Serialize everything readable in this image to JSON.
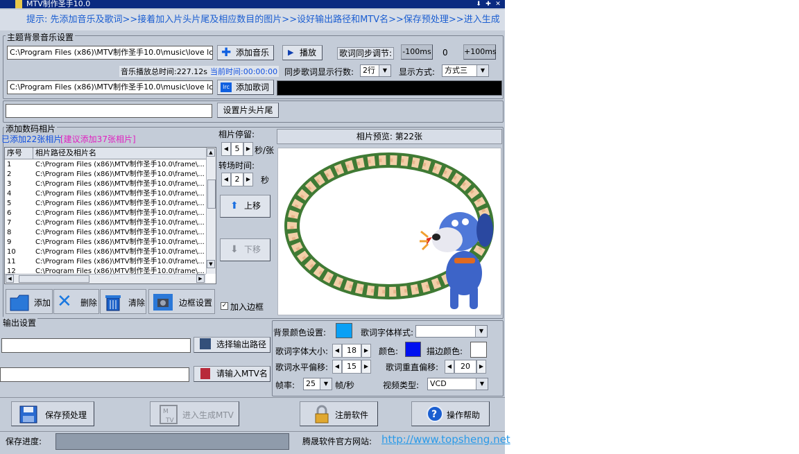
{
  "window": {
    "title": "MTV制作圣手10.0",
    "controls": [
      "⬇",
      "✚",
      "✕"
    ]
  },
  "hint": "提示: 先添加音乐及歌词>>接着加入片头片尾及相应数目的图片>>设好输出路径和MTV名>>保存预处理>>进入生成MTV",
  "music": {
    "group_label": "主题背景音乐设置",
    "music_path": "C:\\Program Files (x86)\\MTV制作圣手10.0\\music\\love love lo",
    "add_music": "添加音乐",
    "play": "播放",
    "sync_label": "歌词同步调节:",
    "minus": "-100ms",
    "offset": "0",
    "plus": "+100ms",
    "total_time": "音乐播放总时间:227.12s",
    "current_time": "当前时间:00:00:00",
    "lines_label": "同步歌词显示行数:",
    "lines_value": "2行",
    "mode_label": "显示方式:",
    "mode_value": "方式三",
    "lyric_path": "C:\\Program Files (x86)\\MTV制作圣手10.0\\music\\love love lo",
    "add_lyric": "添加歌词"
  },
  "trailer": {
    "button": "设置片头片尾",
    "path": ""
  },
  "photos": {
    "group_label": "添加数码相片",
    "added": "已添加22张相片",
    "suggest": "[建议添加37张相片]",
    "col_no": "序号",
    "col_path": "相片路径及相片名",
    "rows": [
      {
        "no": "1",
        "path": "C:\\Program Files (x86)\\MTV制作圣手10.0\\frame\\..."
      },
      {
        "no": "2",
        "path": "C:\\Program Files (x86)\\MTV制作圣手10.0\\frame\\..."
      },
      {
        "no": "3",
        "path": "C:\\Program Files (x86)\\MTV制作圣手10.0\\frame\\..."
      },
      {
        "no": "4",
        "path": "C:\\Program Files (x86)\\MTV制作圣手10.0\\frame\\..."
      },
      {
        "no": "5",
        "path": "C:\\Program Files (x86)\\MTV制作圣手10.0\\frame\\..."
      },
      {
        "no": "6",
        "path": "C:\\Program Files (x86)\\MTV制作圣手10.0\\frame\\..."
      },
      {
        "no": "7",
        "path": "C:\\Program Files (x86)\\MTV制作圣手10.0\\frame\\..."
      },
      {
        "no": "8",
        "path": "C:\\Program Files (x86)\\MTV制作圣手10.0\\frame\\..."
      },
      {
        "no": "9",
        "path": "C:\\Program Files (x86)\\MTV制作圣手10.0\\frame\\..."
      },
      {
        "no": "10",
        "path": "C:\\Program Files (x86)\\MTV制作圣手10.0\\frame\\..."
      },
      {
        "no": "11",
        "path": "C:\\Program Files (x86)\\MTV制作圣手10.0\\frame\\..."
      },
      {
        "no": "12",
        "path": "C:\\Program Files (x86)\\MTV制作圣手10.0\\frame\\..."
      }
    ],
    "stay_label": "相片停留:",
    "stay_value": "5",
    "stay_unit": "秒/张",
    "transition_label": "转场时间:",
    "transition_value": "2",
    "transition_unit": "秒",
    "move_up": "上移",
    "move_down": "下移",
    "preview_label": "相片预览: 第22张",
    "add": "添加",
    "delete": "删除",
    "clear": "清除",
    "frame_setting": "边框设置",
    "add_border": "加入边框"
  },
  "output": {
    "group_label": "输出设置",
    "path": "",
    "choose_path": "选择输出路径",
    "name": "",
    "input_name": "请输入MTV名",
    "bg_color_label": "背景颜色设置:",
    "font_style_label": "歌词字体样式:",
    "font_style_value": "",
    "font_size_label": "歌词字体大小:",
    "font_size_value": "18",
    "color_label": "颜色:",
    "stroke_label": "描边颜色:",
    "h_offset_label": "歌词水平偏移:",
    "h_offset_value": "15",
    "v_offset_label": "歌词重直偏移:",
    "v_offset_value": "20",
    "fps_label": "帧率:",
    "fps_value": "25",
    "fps_unit": "帧/秒",
    "video_type_label": "视频类型:",
    "video_type_value": "VCD",
    "colors": {
      "bg": "#0aa0f5",
      "font": "#0010f0",
      "stroke": "#ffffff"
    }
  },
  "actions": {
    "save": "保存预处理",
    "enter": "进入生成MTV",
    "register": "注册软件",
    "help": "操作帮助"
  },
  "status": {
    "progress_label": "保存进度:",
    "site_label": "腾晟软件官方网站:",
    "site_url": "http://www.topsheng.net"
  }
}
